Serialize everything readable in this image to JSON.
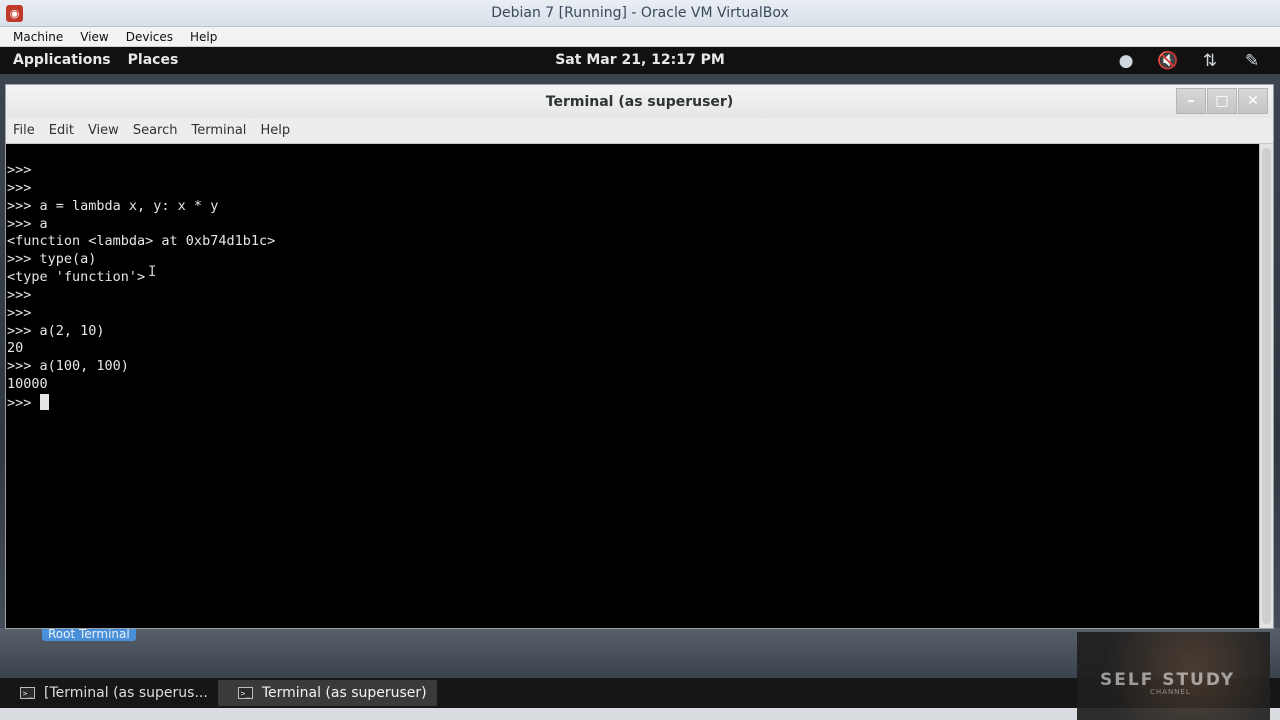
{
  "vbox": {
    "title": "Debian 7 [Running] - Oracle VM VirtualBox",
    "menu": [
      "Machine",
      "View",
      "Devices",
      "Help"
    ]
  },
  "panel": {
    "applications": "Applications",
    "places": "Places",
    "clock": "Sat Mar 21, 12:17 PM",
    "tray_icons": [
      "notification-icon",
      "volume-muted-icon",
      "network-icon",
      "user-icon"
    ]
  },
  "terminal": {
    "title": "Terminal (as superuser)",
    "menu": [
      "File",
      "Edit",
      "View",
      "Search",
      "Terminal",
      "Help"
    ],
    "lines": [
      ">>>",
      ">>>",
      ">>> a = lambda x, y: x * y",
      ">>> a",
      "<function <lambda> at 0xb74d1b1c>",
      ">>> type(a)",
      "<type 'function'>",
      ">>>",
      ">>>",
      ">>> a(2, 10)",
      "20",
      ">>> a(100, 100)",
      "10000"
    ],
    "prompt": ">>> "
  },
  "desktop": {
    "tooltip": "Root Terminal"
  },
  "taskbar": {
    "items": [
      "[Terminal (as superus...",
      "Terminal (as superuser)"
    ]
  },
  "watermark": {
    "title": "SELF STUDY",
    "subtitle": "CHANNEL"
  }
}
